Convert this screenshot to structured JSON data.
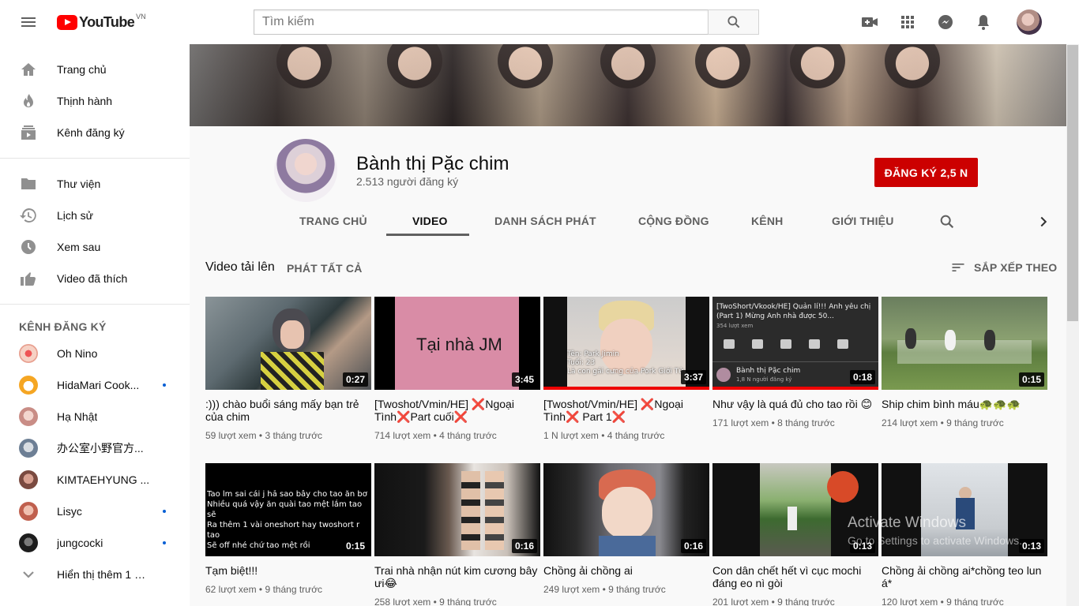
{
  "header": {
    "logo_text": "YouTube",
    "logo_country": "VN",
    "search_placeholder": "Tìm kiếm"
  },
  "icons": {
    "menu": "menu-icon",
    "search": "search-icon",
    "create": "video-camera-icon",
    "apps": "apps-grid-icon",
    "messages": "messages-icon",
    "notifications": "bell-icon"
  },
  "sidebar": {
    "main_items": [
      {
        "label": "Trang chủ",
        "icon": "home-icon"
      },
      {
        "label": "Thịnh hành",
        "icon": "trending-icon"
      },
      {
        "label": "Kênh đăng ký",
        "icon": "subscriptions-icon"
      }
    ],
    "library_items": [
      {
        "label": "Thư viện",
        "icon": "library-icon"
      },
      {
        "label": "Lịch sử",
        "icon": "history-icon"
      },
      {
        "label": "Xem sau",
        "icon": "watch-later-icon"
      },
      {
        "label": "Video đã thích",
        "icon": "like-icon"
      }
    ],
    "subscriptions_heading": "KÊNH ĐĂNG KÝ",
    "subscriptions": [
      {
        "name": "Oh Nino",
        "new": false,
        "color": "#e8a090"
      },
      {
        "name": "HidaMari Cook...",
        "new": true,
        "color": "#f5a623"
      },
      {
        "name": "Hạ Nhật",
        "new": false,
        "color": "#d9a3a0"
      },
      {
        "name": "办公室小野官方...",
        "new": false,
        "color": "#8a9bb0"
      },
      {
        "name": "KIMTAEHYUNG ...",
        "new": false,
        "color": "#a0655a"
      },
      {
        "name": "Lisyc",
        "new": true,
        "color": "#d77c6a"
      },
      {
        "name": "jungcocki",
        "new": true,
        "color": "#2d2d2d"
      }
    ],
    "show_more": "Hiển thị thêm 1 m..."
  },
  "channel": {
    "name": "Bành thị Pặc chim",
    "subscribers": "2.513 người đăng ký",
    "subscribe_label": "ĐĂNG KÝ  2,5 N",
    "tabs": [
      "TRANG CHỦ",
      "VIDEO",
      "DANH SÁCH PHÁT",
      "CỘNG ĐỒNG",
      "KÊNH",
      "GIỚI THIỆU"
    ],
    "active_tab": "VIDEO"
  },
  "section": {
    "title": "Video tải lên",
    "play_all": "PHÁT TẤT CẢ",
    "sort": "SẮP XẾP THEO"
  },
  "thumb_texts": {
    "v2": "Tại nhà JM",
    "v3_line1": "Tên: Park Jimin",
    "v3_line2": "Tuổi: 23",
    "v3_line3": "Là con gái cưng của Pork Giới Tử",
    "v4_line1": "[TwoShort/Vkook/HE] Quản lí!!! Anh yêu chị",
    "v4_line2": "(Part 1) Mừng Anh nhà được 50...",
    "v4_line3": "354 lượt xem",
    "v4_channel": "Bành thị Pặc chim",
    "v4_subs": "1,8 N người đăng ký",
    "v6_line1": "Tao lm sai cái j hả sao bây cho tao ăn bơ",
    "v6_line2": "Nhiều quá vậy ăn quài tao mệt lắm tao sẽ",
    "v6_line3": "Ra thêm 1 vài oneshort hay twoshort r tao",
    "v6_line4": "Sẽ off nhé chứ tao mệt rồi"
  },
  "videos": [
    {
      "title": ":))) chào buổi sáng mấy bạn trẻ của chim",
      "meta": "59 lượt xem • 3 tháng trước",
      "duration": "0:27",
      "progress": false
    },
    {
      "title": "[Twoshot/Vmin/HE] ❌Ngoại Tình❌Part cuối❌",
      "meta": "714 lượt xem • 4 tháng trước",
      "duration": "3:45",
      "progress": false
    },
    {
      "title": "[Twoshot/Vmin/HE] ❌Ngoại Tình❌ Part 1❌",
      "meta": "1 N lượt xem • 4 tháng trước",
      "duration": "3:37",
      "progress": true
    },
    {
      "title": "Như vậy là quá đủ cho tao rồi 😊",
      "meta": "171 lượt xem • 8 tháng trước",
      "duration": "0:18",
      "progress": true
    },
    {
      "title": "Ship chim bình máu🐢🐢🐢",
      "meta": "214 lượt xem • 9 tháng trước",
      "duration": "0:15",
      "progress": false
    },
    {
      "title": "Tạm biệt!!!",
      "meta": "62 lượt xem • 9 tháng trước",
      "duration": "0:15",
      "progress": false
    },
    {
      "title": "Trai nhà nhận nút kim cương bây ưi😂",
      "meta": "258 lượt xem • 9 tháng trước",
      "duration": "0:16",
      "progress": false
    },
    {
      "title": "Chồng ải chồng ai",
      "meta": "249 lượt xem • 9 tháng trước",
      "duration": "0:16",
      "progress": false
    },
    {
      "title": "Con dân chết hết vì cục mochi đáng eo nì gòi",
      "meta": "201 lượt xem • 9 tháng trước",
      "duration": "0:13",
      "progress": false
    },
    {
      "title": "Chồng ải chồng ai*chồng teo lun á*",
      "meta": "120 lượt xem • 9 tháng trước",
      "duration": "0:13",
      "progress": false
    }
  ],
  "watermark": {
    "line1": "Activate Windows",
    "line2": "Go to Settings to activate Windows."
  }
}
